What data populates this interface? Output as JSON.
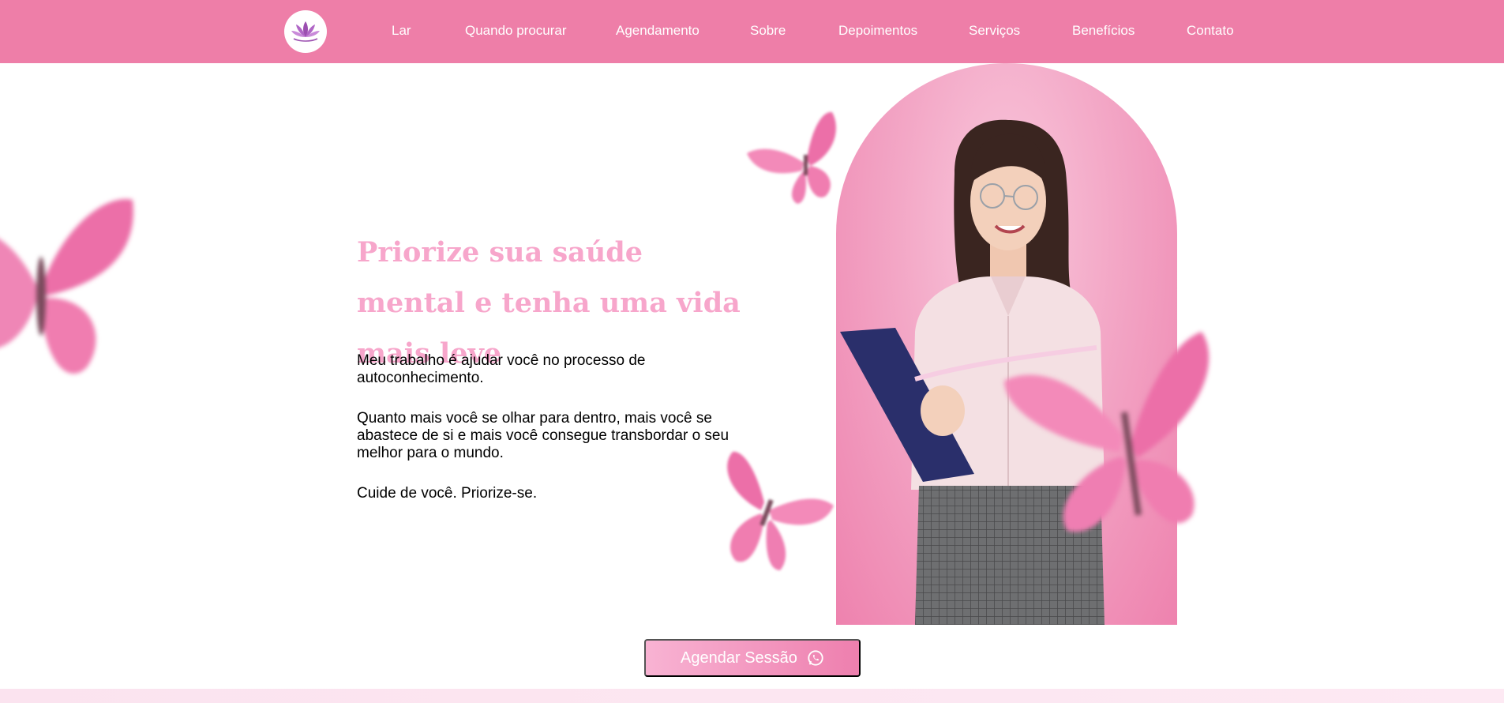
{
  "nav": {
    "logo_icon": "lotus-icon",
    "items": [
      {
        "label": "Lar"
      },
      {
        "label": "Quando procurar"
      },
      {
        "label": "Agendamento"
      },
      {
        "label": "Sobre"
      },
      {
        "label": "Depoimentos"
      },
      {
        "label": "Serviços"
      },
      {
        "label": "Benefícios"
      },
      {
        "label": "Contato"
      }
    ]
  },
  "hero": {
    "title": "Priorize sua saúde mental e tenha uma vida mais leve",
    "paragraphs": [
      "Meu trabalho é ajudar você no processo de autoconhecimento.",
      "Quanto mais você se olhar para dentro, mais você se abastece de si e mais você consegue transbordar o seu melhor para o mundo.",
      "Cuide de você. Priorize-se."
    ]
  },
  "cta": {
    "label": "Agendar Sessão",
    "icon": "whatsapp-icon"
  },
  "colors": {
    "nav_bg": "#ee7ea8",
    "title_pink": "#f7a6cb",
    "arch_pink": "#ee82ae",
    "butterfly_pink": "#ec6fa8"
  }
}
